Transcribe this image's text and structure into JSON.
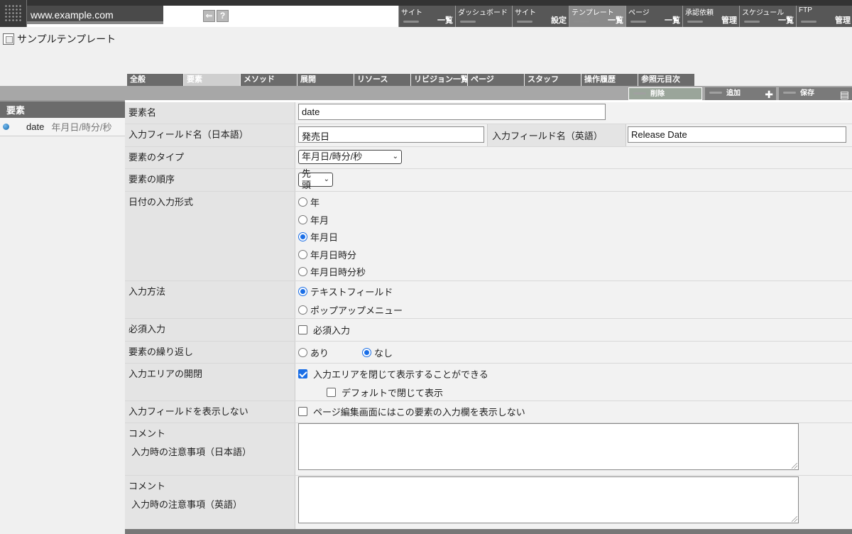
{
  "header": {
    "site_url": "www.example.com",
    "mini_icons": [
      "⇐",
      "?"
    ],
    "nav": [
      {
        "label": "サイト",
        "sub": "一覧"
      },
      {
        "label": "ダッシュボード",
        "sub": ""
      },
      {
        "label": "サイト",
        "sub": "設定"
      },
      {
        "label": "テンプレート",
        "sub": "一覧"
      },
      {
        "label": "ページ",
        "sub": "一覧"
      },
      {
        "label": "承認依頼",
        "sub": "管理"
      },
      {
        "label": "スケジュール",
        "sub": "一覧"
      },
      {
        "label": "FTP",
        "sub": "管理"
      }
    ]
  },
  "page_title": "サンプルテンプレート",
  "tabs": [
    "全般",
    "要素",
    "メソッド",
    "展開",
    "リソース",
    "リビジョン一覧",
    "ページ",
    "スタッフ",
    "操作履歴",
    "参照元目次"
  ],
  "toolbar": {
    "delete": "削除",
    "add": "追加",
    "save": "保存"
  },
  "sidebar": {
    "title": "要素",
    "item_name": "date",
    "item_type": "年月日/時分/秒"
  },
  "form": {
    "element_name": {
      "label": "要素名",
      "value": "date"
    },
    "field_name": {
      "label_ja": "入力フィールド名（日本語）",
      "value_ja": "発売日",
      "label_en": "入力フィールド名（英語）",
      "value_en": "Release Date"
    },
    "element_type": {
      "label": "要素のタイプ",
      "value": "年月日/時分/秒"
    },
    "element_order": {
      "label": "要素の順序",
      "value": "先頭"
    },
    "date_format": {
      "label": "日付の入力形式",
      "options": [
        "年",
        "年月",
        "年月日",
        "年月日時分",
        "年月日時分秒"
      ],
      "selected": "年月日"
    },
    "input_method": {
      "label": "入力方法",
      "options": [
        "テキストフィールド",
        "ポップアップメニュー"
      ],
      "selected": "テキストフィールド"
    },
    "required": {
      "label": "必須入力",
      "checkbox": "必須入力",
      "checked": false
    },
    "repeat": {
      "label": "要素の繰り返し",
      "options": [
        "あり",
        "なし"
      ],
      "selected": "なし"
    },
    "collapse": {
      "label": "入力エリアの開閉",
      "check1": "入力エリアを閉じて表示することができる",
      "check1_on": true,
      "check2": "デフォルトで閉じて表示",
      "check2_on": false
    },
    "hide_field": {
      "label": "入力フィールドを表示しない",
      "checkbox": "ページ編集画面にはこの要素の入力欄を表示しない",
      "checked": false
    },
    "comment_ja": {
      "label": "コメント",
      "sub": "入力時の注意事項（日本語）"
    },
    "comment_en": {
      "label": "コメント",
      "sub": "入力時の注意事項（英語）"
    }
  }
}
